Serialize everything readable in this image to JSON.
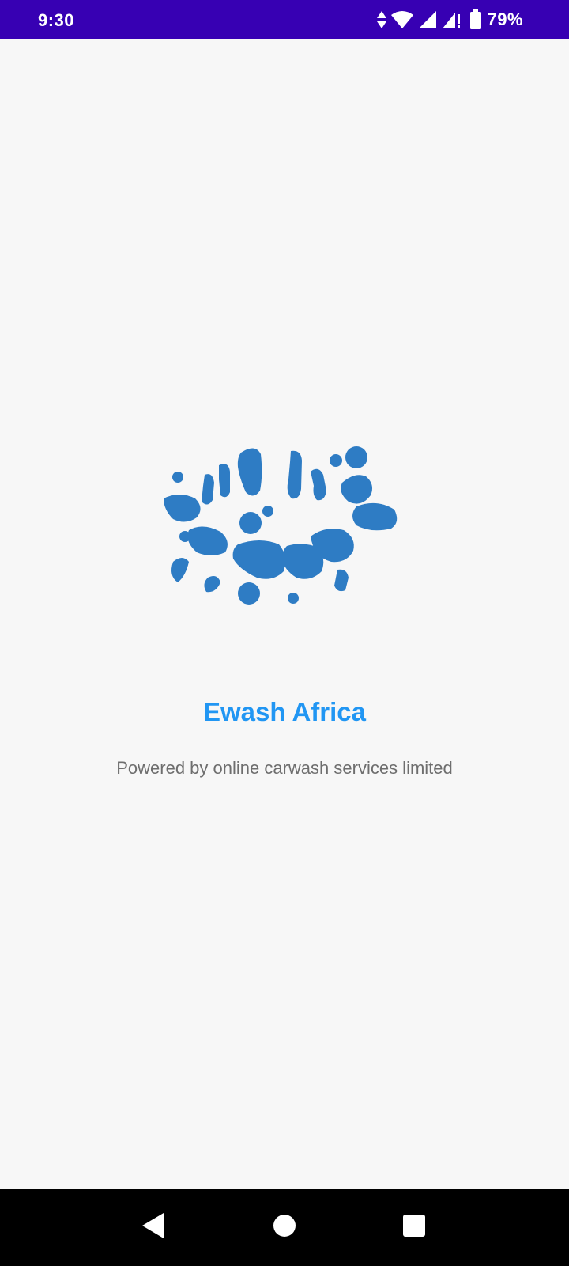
{
  "status_bar": {
    "time": "9:30",
    "battery_percent": "79%",
    "icons": [
      "data-arrows-icon",
      "wifi-icon",
      "signal-icon",
      "signal-alert-icon",
      "battery-icon"
    ],
    "background": "#3700b3"
  },
  "splash": {
    "logo_icon": "water-splash-logo",
    "app_name": "Ewash Africa",
    "tagline": "Powered by online carwash services limited",
    "accent_color": "#2196f3",
    "logo_color": "#2e7cc4"
  },
  "nav_bar": {
    "buttons": [
      "back",
      "home",
      "recents"
    ]
  }
}
